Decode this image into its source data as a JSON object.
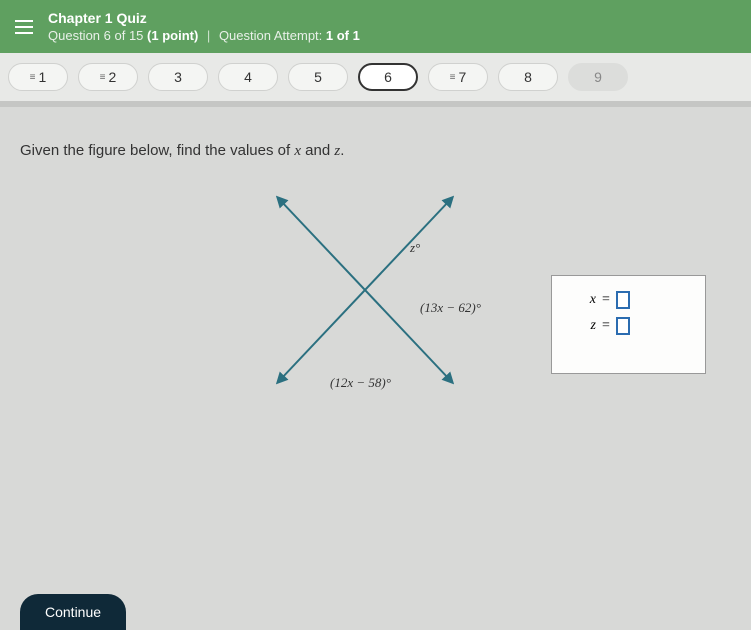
{
  "header": {
    "title": "Chapter 1 Quiz",
    "question_line_prefix": "Question ",
    "question_num": "6",
    "question_of": " of 15 ",
    "points": "(1 point)",
    "attempt_label": "Question Attempt: ",
    "attempt_value": "1 of 1"
  },
  "nav": {
    "items": [
      {
        "label": "1",
        "answered": true
      },
      {
        "label": "2",
        "answered": true
      },
      {
        "label": "3",
        "answered": false
      },
      {
        "label": "4",
        "answered": false
      },
      {
        "label": "5",
        "answered": false
      },
      {
        "label": "6",
        "answered": false,
        "current": true
      },
      {
        "label": "7",
        "answered": true
      },
      {
        "label": "8",
        "answered": false
      },
      {
        "label": "9",
        "answered": false,
        "disabled": true
      }
    ]
  },
  "prompt": {
    "text_before": "Given the figure below, find the values of ",
    "var1": "x",
    "text_mid": " and ",
    "var2": "z",
    "text_after": "."
  },
  "figure": {
    "angle_top": "z°",
    "angle_right": "(13x − 62)°",
    "angle_bottom": "(12x − 58)°"
  },
  "answers": {
    "x_label": "x",
    "z_label": "z",
    "eq": "="
  },
  "continue_label": "Continue"
}
